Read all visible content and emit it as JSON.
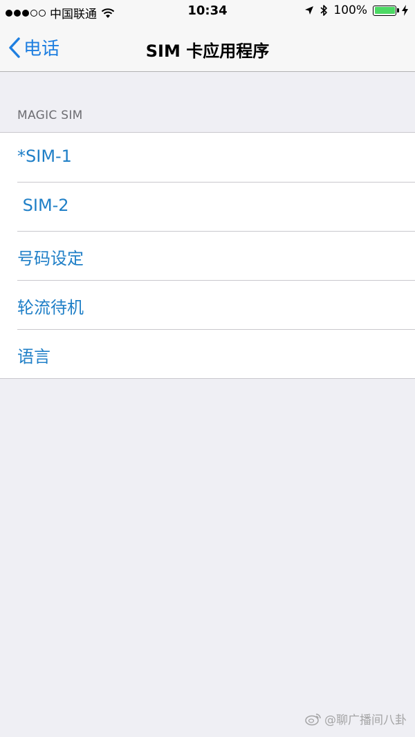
{
  "status_bar": {
    "carrier": "中国联通",
    "time": "10:34",
    "battery": "100%",
    "battery_level": 1.0,
    "signal_strength": 3,
    "signal_max": 5,
    "icons": [
      "wifi-icon",
      "location-arrow-icon",
      "bluetooth-icon",
      "battery-icon",
      "charging-bolt-icon"
    ]
  },
  "nav": {
    "back_label": "电话",
    "title": "SIM 卡应用程序"
  },
  "section": {
    "header": "MAGIC SIM"
  },
  "items": [
    {
      "label": "*SIM-1"
    },
    {
      "label": " SIM-2"
    },
    {
      "label": "号码设定"
    },
    {
      "label": "轮流待机"
    },
    {
      "label": "语言"
    }
  ],
  "watermark": {
    "text": "@聊广播间八卦"
  },
  "colors": {
    "accent": "#1f7fe0",
    "item_text": "#1f7fc7",
    "background": "#efeff4",
    "battery": "#4cd964"
  }
}
